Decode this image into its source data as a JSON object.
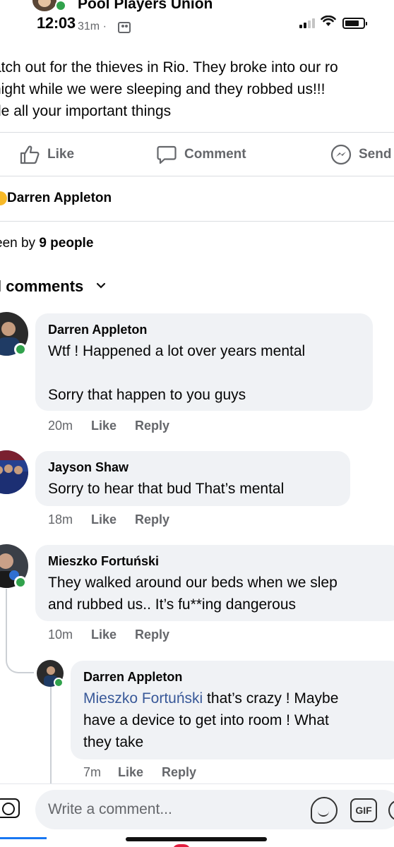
{
  "status_bar": {
    "time": "12:03",
    "signal_bars_filled": 2,
    "signal_bars_total": 4,
    "battery_level": 0.8
  },
  "post": {
    "group_name": "Pool Players Union",
    "time": "31m ·",
    "text_lines": [
      "atch out for the thieves in Rio. They broke into our ro",
      " night while we were sleeping and they robbed us!!!",
      "de all your important things"
    ]
  },
  "actions": {
    "like": "Like",
    "comment": "Comment",
    "send": "Send"
  },
  "reactor": "Darren Appleton",
  "seen": {
    "prefix": "een by ",
    "count_text": "9 people"
  },
  "comments_filter": {
    "label": "l comments",
    "chevron": "⌄"
  },
  "comments": [
    {
      "author": "Darren Appleton",
      "lines": [
        "Wtf ! Happened a lot over years mental",
        "",
        "Sorry that happen to you guys"
      ],
      "time": "20m",
      "like": "Like",
      "reply": "Reply"
    },
    {
      "author": "Jayson Shaw",
      "lines": [
        "Sorry to hear that bud That’s mental"
      ],
      "time": "18m",
      "like": "Like",
      "reply": "Reply"
    },
    {
      "author": "Mieszko Fortuński",
      "lines": [
        "They walked around our beds when we slep",
        "and rubbed us.. It’s fu**ing dangerous"
      ],
      "time": "10m",
      "like": "Like",
      "reply": "Reply"
    }
  ],
  "reply": {
    "author": "Darren Appleton",
    "mention": "Mieszko Fortuński",
    "line1_rest": " that’s crazy ! Maybe",
    "line2": "have a device to get into room ! What",
    "line3": "they take",
    "time": "7m",
    "like": "Like",
    "reply": "Reply"
  },
  "composer": {
    "placeholder": "Write a comment...",
    "gif_label": "GIF"
  },
  "colors": {
    "accent": "#1877f2",
    "online": "#31a24c",
    "bubble": "#f0f2f5",
    "muted": "#65676b",
    "mention": "#385898"
  },
  "icons": [
    "camera-icon",
    "sticker-icon",
    "gif-icon",
    "like-icon",
    "comment-icon",
    "messenger-icon",
    "wifi-icon",
    "battery-icon",
    "audience-icon"
  ]
}
